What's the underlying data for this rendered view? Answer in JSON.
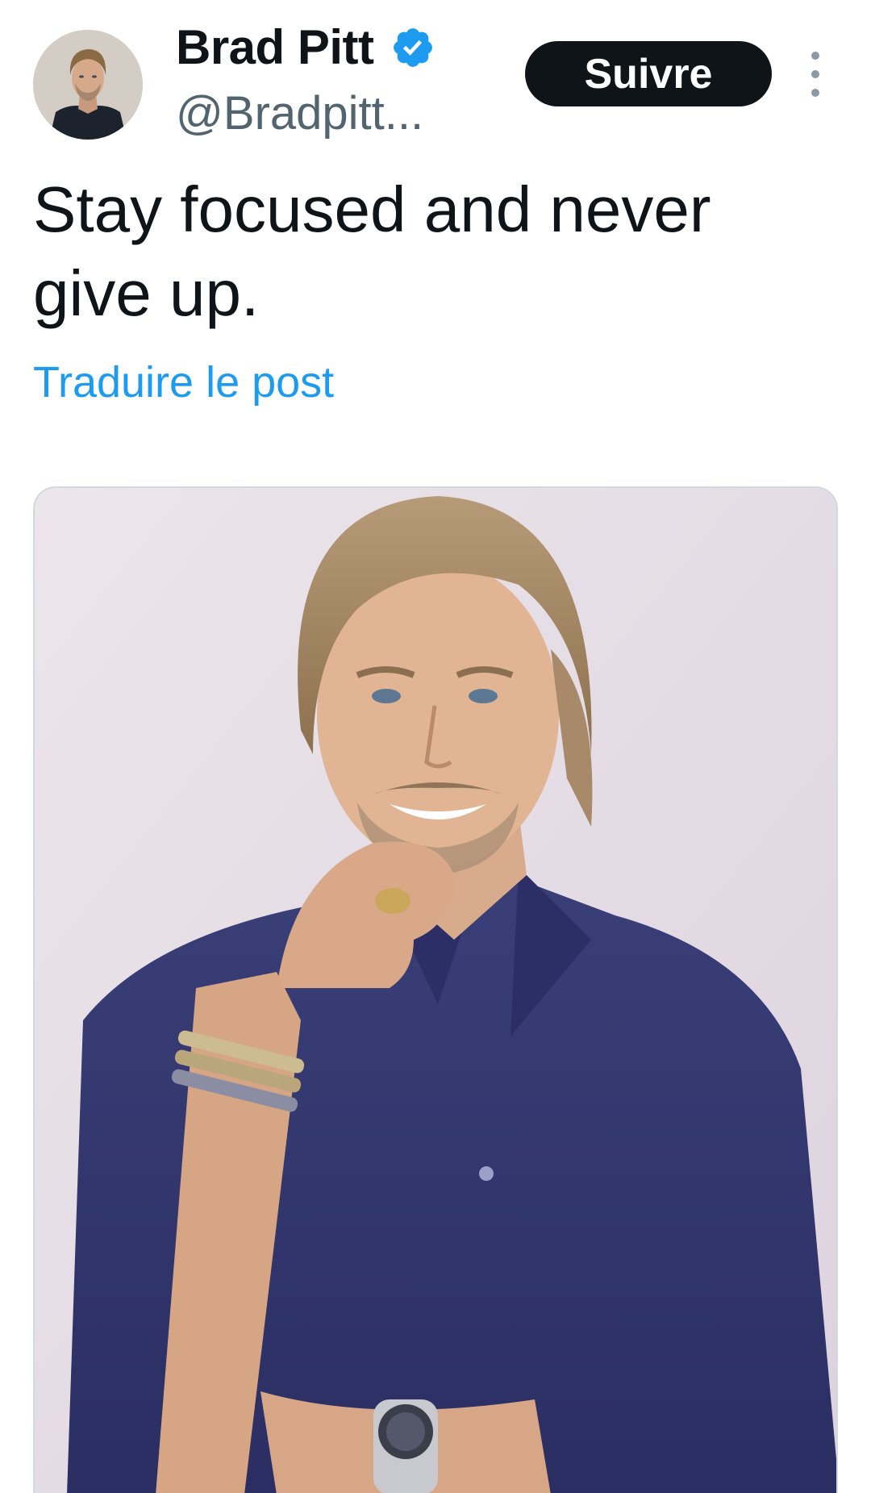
{
  "post": {
    "author": {
      "display_name": "Brad Pitt",
      "handle": "@Bradpitt...",
      "verified": true,
      "verified_color": "#1d9bf0"
    },
    "follow_label": "Suivre",
    "text": "Stay focused and never give up.",
    "translate_label": "Traduire le post"
  },
  "icons": {
    "verified": "verified-badge-icon",
    "more": "more-vertical-icon"
  },
  "colors": {
    "text_primary": "#0f1419",
    "text_secondary": "#536471",
    "link": "#1d9bf0",
    "button_bg": "#0f1419",
    "button_text": "#ffffff"
  }
}
